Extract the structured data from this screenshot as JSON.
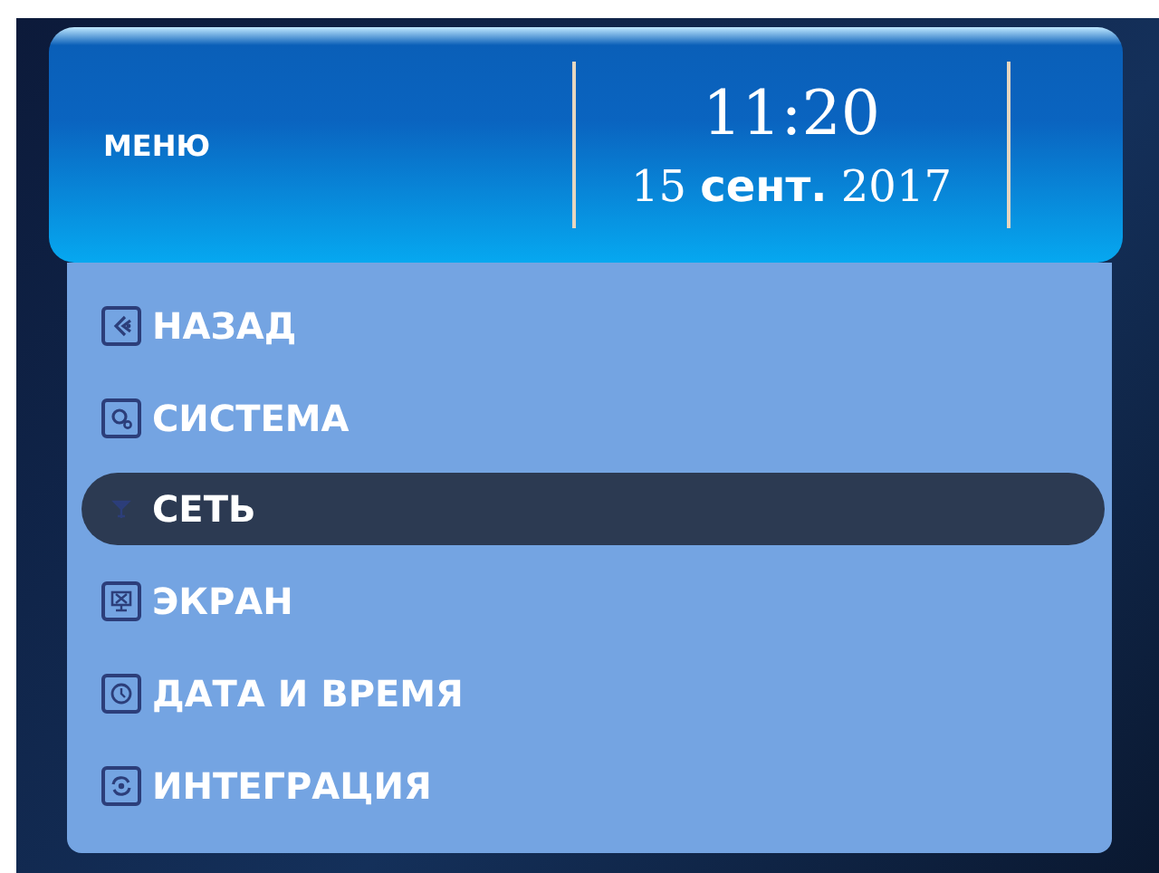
{
  "header": {
    "title": "МЕНЮ",
    "time": "11:20",
    "date": "15 **сент.** 2017"
  },
  "menu": [
    {
      "kind": "back",
      "label": "НАЗАД",
      "selected": false
    },
    {
      "kind": "system",
      "label": "СИСТЕМА",
      "selected": false
    },
    {
      "kind": "network",
      "label": "СЕТЬ",
      "selected": true
    },
    {
      "kind": "screen",
      "label": "ЭКРАН",
      "selected": false
    },
    {
      "kind": "clock",
      "label": "ДАТА И ВРЕМЯ",
      "selected": false
    },
    {
      "kind": "integration",
      "label": "ИНТЕГРАЦИЯ",
      "selected": false
    }
  ]
}
